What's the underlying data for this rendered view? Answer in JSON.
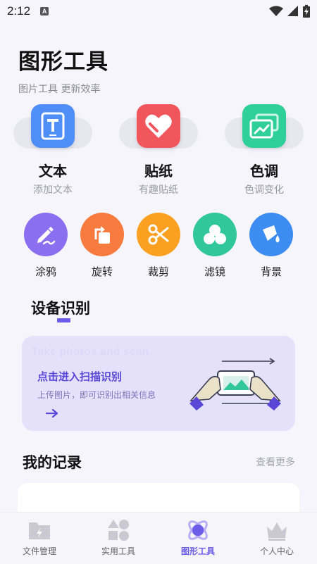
{
  "status_bar": {
    "time": "2:12",
    "notification": "A"
  },
  "header": {
    "title": "图形工具",
    "subtitle": "图片工具 更新效率"
  },
  "big_tools": [
    {
      "label": "文本",
      "sub": "添加文本",
      "icon": "text-icon",
      "color": "#4f8ef7"
    },
    {
      "label": "贴纸",
      "sub": "有趣贴纸",
      "icon": "heart-sticker-icon",
      "color": "#f0565b"
    },
    {
      "label": "色调",
      "sub": "色调变化",
      "icon": "photo-tone-icon",
      "color": "#2fcf9a"
    }
  ],
  "small_tools": [
    {
      "label": "涂鸦",
      "icon": "pen-icon",
      "color": "#8b6ff0"
    },
    {
      "label": "旋转",
      "icon": "rotate-icon",
      "color": "#f77a3e"
    },
    {
      "label": "裁剪",
      "icon": "scissors-icon",
      "color": "#fba021"
    },
    {
      "label": "滤镜",
      "icon": "filter-icon",
      "color": "#2fc79b"
    },
    {
      "label": "背景",
      "icon": "paint-bucket-icon",
      "color": "#3d8cf2"
    }
  ],
  "scan_section": {
    "title": "设备识别",
    "watermark": "Take photos and scan",
    "card_title": "点击进入扫描识别",
    "card_desc": "上传图片，即可识别出相关信息"
  },
  "records": {
    "title": "我的记录",
    "more": "查看更多"
  },
  "bottom_nav": [
    {
      "label": "文件管理",
      "icon": "file-manager-icon",
      "active": false
    },
    {
      "label": "实用工具",
      "icon": "utility-tools-icon",
      "active": false
    },
    {
      "label": "图形工具",
      "icon": "graphic-tools-icon",
      "active": true
    },
    {
      "label": "个人中心",
      "icon": "profile-crown-icon",
      "active": false
    }
  ],
  "colors": {
    "accent": "#6c5ce7",
    "background": "#f6f5fb",
    "card_bg": "#e6e1fb"
  }
}
